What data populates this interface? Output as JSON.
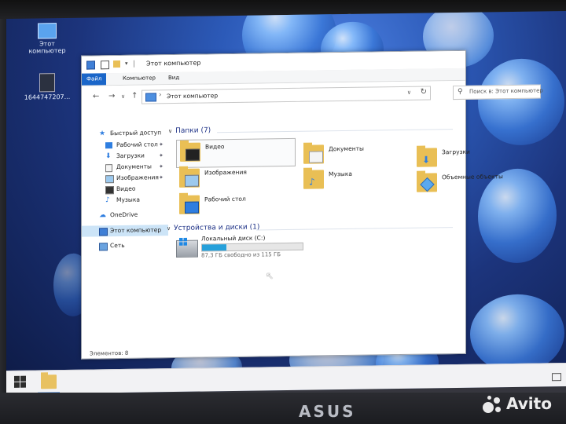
{
  "window": {
    "title": "Этот компьютер"
  },
  "ribbon": {
    "tabs": [
      "Файл",
      "Компьютер",
      "Вид"
    ]
  },
  "address": {
    "path": "Этот компьютер",
    "dropdown": "∨",
    "refresh": "↻"
  },
  "search": {
    "placeholder": "Поиск в: Этот компьютер"
  },
  "nav": {
    "back": "←",
    "forward": "→",
    "recent": "∨",
    "up": "↑",
    "items": [
      {
        "label": "Быстрый доступ",
        "icon": "star-icon",
        "pinned": false
      },
      {
        "label": "Рабочий стол",
        "icon": "desktop-icon",
        "pinned": true
      },
      {
        "label": "Загрузки",
        "icon": "download-icon",
        "pinned": true
      },
      {
        "label": "Документы",
        "icon": "document-icon",
        "pinned": true
      },
      {
        "label": "Изображения",
        "icon": "image-icon",
        "pinned": true
      },
      {
        "label": "Видео",
        "icon": "video-icon",
        "pinned": false
      },
      {
        "label": "Музыка",
        "icon": "music-icon",
        "pinned": false
      },
      {
        "label": "OneDrive",
        "icon": "cloud-icon",
        "pinned": false
      },
      {
        "label": "Этот компьютер",
        "icon": "computer-icon",
        "pinned": false
      },
      {
        "label": "Сеть",
        "icon": "network-icon",
        "pinned": false
      }
    ]
  },
  "folders": {
    "header": "Папки (7)",
    "items": [
      {
        "label": "Видео",
        "icon": "video-folder-icon"
      },
      {
        "label": "Документы",
        "icon": "documents-folder-icon"
      },
      {
        "label": "Загрузки",
        "icon": "downloads-folder-icon"
      },
      {
        "label": "Изображения",
        "icon": "pictures-folder-icon"
      },
      {
        "label": "Музыка",
        "icon": "music-folder-icon"
      },
      {
        "label": "Объемные объекты",
        "icon": "3d-objects-folder-icon"
      },
      {
        "label": "Рабочий стол",
        "icon": "desktop-folder-icon"
      }
    ]
  },
  "devices": {
    "header": "Устройства и диски (1)",
    "drive": {
      "name": "Локальный диск (C:)",
      "free_text": "87,3 ГБ свободно из 115 ГБ",
      "used_fraction": 0.24
    }
  },
  "status": {
    "items": "Элементов: 8"
  },
  "desktop": {
    "icon1_label": "Этот компьютер",
    "icon2_label": "1644747207..."
  },
  "brand": {
    "laptop": "ASUS",
    "watermark": "Avito"
  },
  "colors": {
    "accent": "#1a66c9",
    "selection": "#cce4f7",
    "drive_fill": "#26a0da",
    "folder": "#e9bf55",
    "group_header": "#1e3287"
  }
}
